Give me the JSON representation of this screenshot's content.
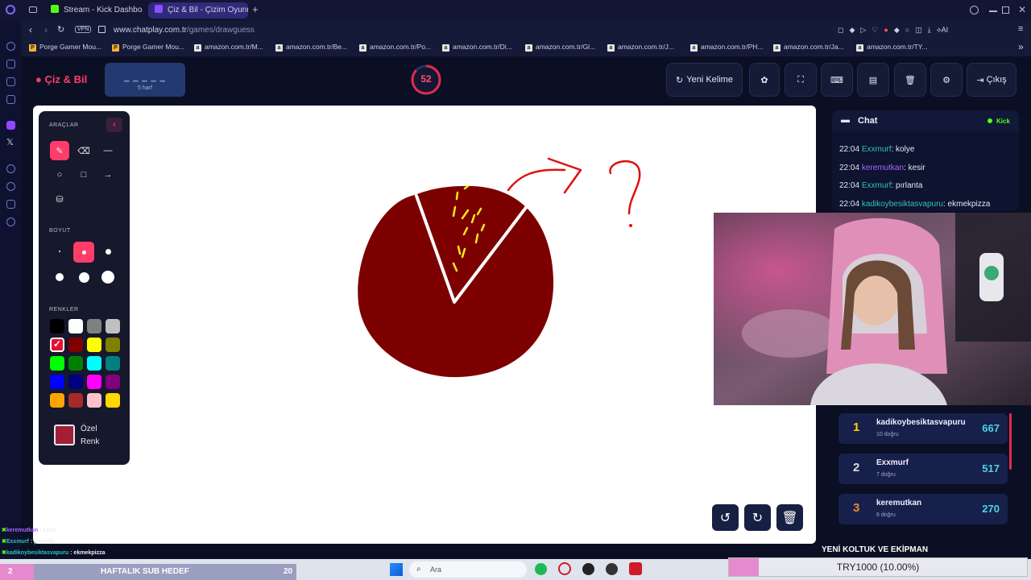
{
  "browser": {
    "tabs": [
      {
        "label": "Stream - Kick Dashboard",
        "icon": "kick-icon",
        "color": "#53fc18"
      },
      {
        "label": "Çiz & Bil - Çizim Oyunu",
        "icon": "chatplay-icon",
        "color": "#8a4fff"
      }
    ],
    "new_tab_label": "+",
    "url_host": "www.chatplay.com.tr",
    "url_path": "/games/drawguess",
    "vpn_label": "VPN",
    "ai_label": "AI",
    "bookmarks": [
      "Porge Gamer Mou...",
      "Porge Gamer Mou...",
      "amazon.com.tr/M...",
      "amazon.com.tr/Be...",
      "amazon.com.tr/Po...",
      "amazon.com.tr/Di...",
      "amazon.com.tr/Gl...",
      "amazon.com.tr/J...",
      "amazon.com.tr/PH...",
      "amazon.com.tr/Ja...",
      "amazon.com.tr/TY..."
    ],
    "bookmarks_more": "»"
  },
  "game": {
    "logo": "Çiz & Bil",
    "word_mask": "_ _ _ _ _",
    "word_hint": "5 harf",
    "timer": "52",
    "timer_fraction": 0.87,
    "new_word_label": "Yeni Kelime",
    "exit_label": "Çıkış"
  },
  "tools": {
    "tools_title": "ARAÇLAR",
    "size_title": "BOYUT",
    "colors_title": "RENKLER",
    "custom_color_label_1": "Özel",
    "custom_color_label_2": "Renk",
    "custom_color": "#a31f36",
    "selected_color": "#e8112d",
    "palette": [
      "#000000",
      "#ffffff",
      "#808080",
      "#c0c0c0",
      "#e8112d",
      "#800000",
      "#ffff00",
      "#808000",
      "#00ff00",
      "#008000",
      "#00ffff",
      "#008080",
      "#0000ff",
      "#000080",
      "#ff00ff",
      "#800080",
      "#ffa500",
      "#a52a2a",
      "#ffc0cb",
      "#ffd700"
    ]
  },
  "chat": {
    "title": "Chat",
    "platform": "Kick",
    "messages": [
      {
        "time": "22:04",
        "user": "Exxmurf",
        "text": "kolye",
        "color": "#2ec4b6"
      },
      {
        "time": "22:04",
        "user": "keremutkan",
        "text": "kesir",
        "color": "#a866ff"
      },
      {
        "time": "22:04",
        "user": "Exxmurf",
        "text": "pırlanta",
        "color": "#2ec4b6"
      },
      {
        "time": "22:04",
        "user": "kadikoybesiktasvapuru",
        "text": "ekmekpizza",
        "color": "#2ec4b6"
      }
    ]
  },
  "leaderboard": [
    {
      "rank": "1",
      "name": "kadikoybesiktasvapuru",
      "sub": "10 doğru",
      "score": "667",
      "rank_color": "#ffd400"
    },
    {
      "rank": "2",
      "name": "Exxmurf",
      "sub": "7 doğru",
      "score": "517",
      "rank_color": "#d9dbe6"
    },
    {
      "rank": "3",
      "name": "keremutkan",
      "sub": "6 doğru",
      "score": "270",
      "rank_color": "#e08a3c"
    }
  ],
  "overlay": {
    "chat_lines": [
      {
        "user": "keremutkan",
        "text": "kesir"
      },
      {
        "user": "Exxmurf",
        "text": "pırlanta"
      },
      {
        "user": "kadikoybesiktasvapuru",
        "text": "ekmekpizza"
      }
    ],
    "sub_goal_label": "HAFTALIK SUB HEDEF",
    "sub_goal_count": "20",
    "sub_goal_left": "2",
    "sponsor_text": "YENİ KOLTUK VE EKİPMAN",
    "donation_text": "TRY1000 (10.00%)",
    "donation_fraction": 0.1
  },
  "taskbar": {
    "search_placeholder": "Ara"
  }
}
